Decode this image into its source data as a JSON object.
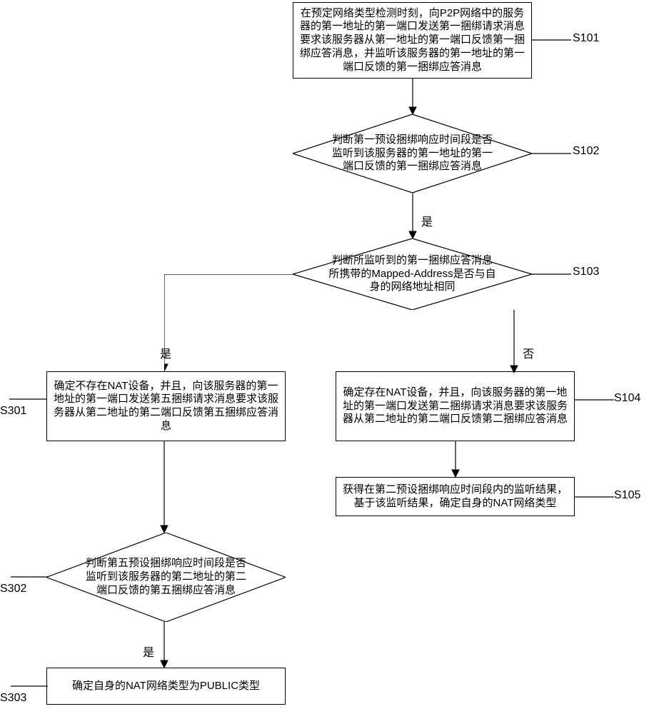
{
  "chart_data": {
    "type": "flowchart",
    "nodes": [
      {
        "id": "S101",
        "type": "process",
        "text": "在预定网络类型检测时刻，向P2P网络中的服务器的第一地址的第一端口发送第一捆绑请求消息要求该服务器从第一地址的第一端口反馈第一捆绑应答消息，并监听该服务器的第一地址的第一端口反馈的第一捆绑应答消息"
      },
      {
        "id": "S102",
        "type": "decision",
        "text": "判断第一预设捆绑响应时间段是否监听到该服务器的第一地址的第一端口反馈的第一捆绑应答消息"
      },
      {
        "id": "S103",
        "type": "decision",
        "text": "判断所监听到的第一捆绑应答消息所携带的Mapped-Address是否与自身的网络地址相同"
      },
      {
        "id": "S301",
        "type": "process",
        "text": "确定不存在NAT设备，并且，向该服务器的第一地址的第一端口发送第五捆绑请求消息要求该服务器从第二地址的第二端口反馈第五捆绑应答消息"
      },
      {
        "id": "S104",
        "type": "process",
        "text": "确定存在NAT设备，并且，向该服务器的第一地址的第一端口发送第二捆绑请求消息要求该服务器从第二地址的第二端口反馈第二捆绑应答消息"
      },
      {
        "id": "S105",
        "type": "process",
        "text": "获得在第二预设捆绑响应时间段内的监听结果，基于该监听结果，确定自身的NAT网络类型"
      },
      {
        "id": "S302",
        "type": "decision",
        "text": "判断第五预设捆绑响应时间段是否监听到该服务器的第二地址的第二端口反馈的第五捆绑应答消息"
      },
      {
        "id": "S303",
        "type": "process",
        "text": "确定自身的NAT网络类型为PUBLIC类型"
      }
    ],
    "edges": [
      {
        "from": "S101",
        "to": "S102"
      },
      {
        "from": "S102",
        "to": "S103",
        "label": "是"
      },
      {
        "from": "S103",
        "to": "S301",
        "label": "是"
      },
      {
        "from": "S103",
        "to": "S104",
        "label": "否"
      },
      {
        "from": "S104",
        "to": "S105"
      },
      {
        "from": "S301",
        "to": "S302"
      },
      {
        "from": "S302",
        "to": "S303",
        "label": "是"
      }
    ]
  },
  "nodes": {
    "s101": {
      "label": "S101",
      "text": "在预定网络类型检测时刻，向P2P网络中的服务器的第一地址的第一端口发送第一捆绑请求消息要求该服务器从第一地址的第一端口反馈第一捆绑应答消息，并监听该服务器的第一地址的第一端口反馈的第一捆绑应答消息"
    },
    "s102": {
      "label": "S102",
      "text": "判断第一预设捆绑响应时间段是否监听到该服务器的第一地址的第一端口反馈的第一捆绑应答消息"
    },
    "s103": {
      "label": "S103",
      "text": "判断所监听到的第一捆绑应答消息所携带的Mapped-Address是否与自身的网络地址相同"
    },
    "s301": {
      "label": "S301",
      "text": "确定不存在NAT设备，并且，向该服务器的第一地址的第一端口发送第五捆绑请求消息要求该服务器从第二地址的第二端口反馈第五捆绑应答消息"
    },
    "s104": {
      "label": "S104",
      "text": "确定存在NAT设备，并且，向该服务器的第一地址的第一端口发送第二捆绑请求消息要求该服务器从第二地址的第二端口反馈第二捆绑应答消息"
    },
    "s105": {
      "label": "S105",
      "text": "获得在第二预设捆绑响应时间段内的监听结果，基于该监听结果，确定自身的NAT网络类型"
    },
    "s302": {
      "label": "S302",
      "text": "判断第五预设捆绑响应时间段是否监听到该服务器的第二地址的第二端口反馈的第五捆绑应答消息"
    },
    "s303": {
      "label": "S303",
      "text": "确定自身的NAT网络类型为PUBLIC类型"
    }
  },
  "edge_labels": {
    "s102_s103": "是",
    "s103_s301": "是",
    "s103_s104": "否",
    "s302_s303": "是"
  }
}
